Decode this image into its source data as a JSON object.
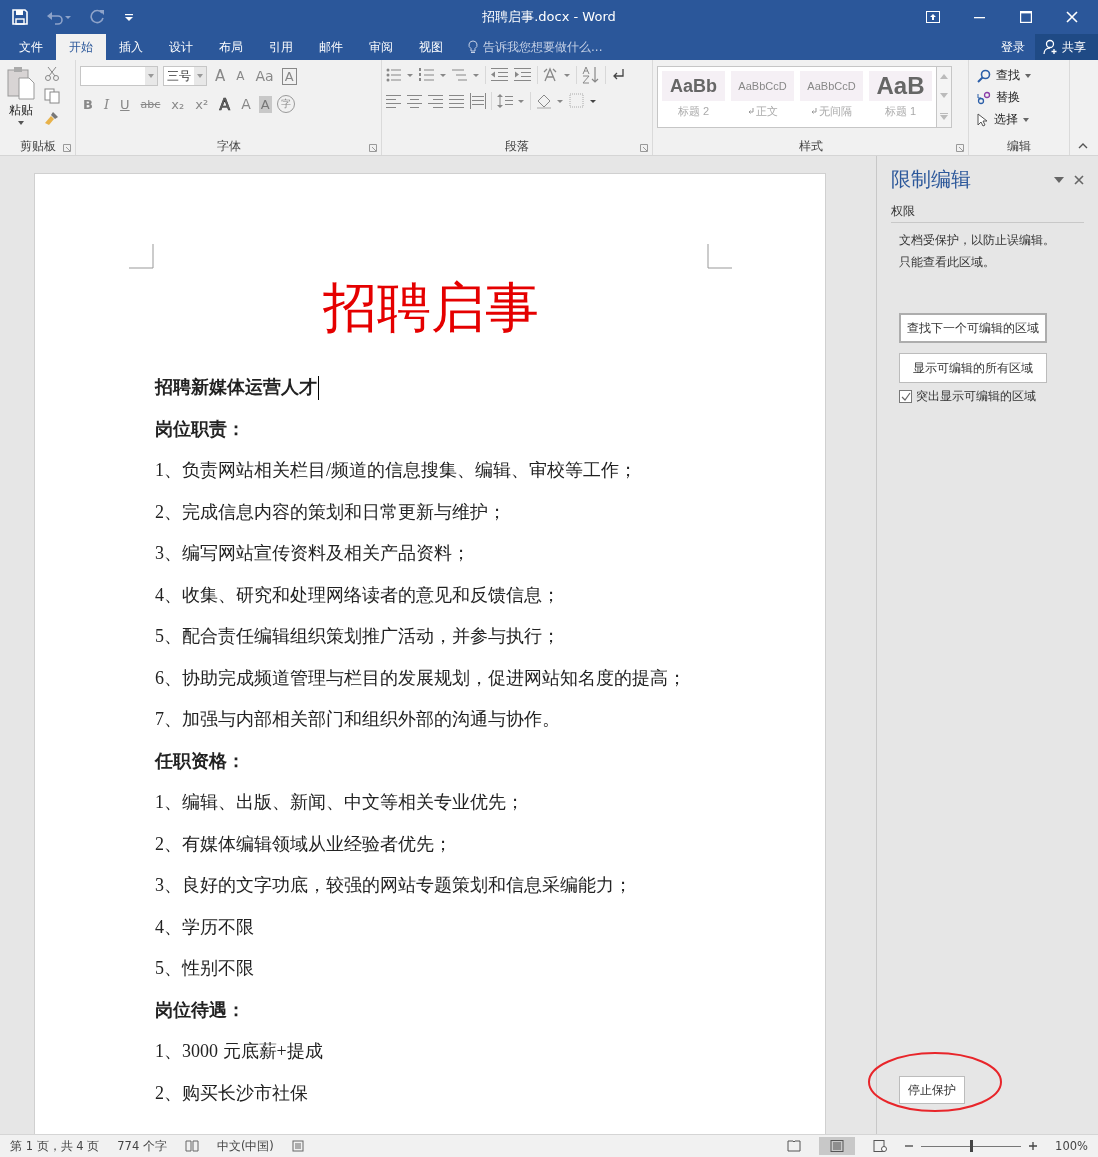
{
  "window": {
    "title": "招聘启事.docx - Word"
  },
  "tabs": [
    {
      "label": "文件",
      "selected": false
    },
    {
      "label": "开始",
      "selected": true
    },
    {
      "label": "插入",
      "selected": false
    },
    {
      "label": "设计",
      "selected": false
    },
    {
      "label": "布局",
      "selected": false
    },
    {
      "label": "引用",
      "selected": false
    },
    {
      "label": "邮件",
      "selected": false
    },
    {
      "label": "审阅",
      "selected": false
    },
    {
      "label": "视图",
      "selected": false
    }
  ],
  "tell_me": {
    "placeholder": "告诉我您想要做什么..."
  },
  "account": {
    "sign_in": "登录",
    "share": "共享"
  },
  "ribbon": {
    "clipboard": {
      "paste": "粘贴",
      "label": "剪贴板"
    },
    "font": {
      "size": "三号",
      "label": "字体",
      "row1": [
        {
          "label": "A",
          "kind": "grow"
        },
        {
          "label": "A",
          "kind": "shrink"
        },
        {
          "label": "Aa",
          "kind": "dropdown"
        },
        {
          "label": "A",
          "kind": "boxed"
        }
      ],
      "row2": [
        {
          "label": "B",
          "kind": "bold"
        },
        {
          "label": "I",
          "kind": "italic"
        },
        {
          "label": "U",
          "kind": "underline"
        },
        {
          "label": "abc",
          "kind": "strike"
        },
        {
          "label": "x₂",
          "kind": "plain"
        },
        {
          "label": "x²",
          "kind": "plain"
        },
        {
          "label": "A",
          "kind": "outline"
        },
        {
          "label": "A",
          "kind": "dropdown"
        },
        {
          "label": "A",
          "kind": "shaded"
        },
        {
          "label": "字",
          "kind": "circled"
        }
      ]
    },
    "paragraph": {
      "label": "段落"
    },
    "styles": {
      "label": "样式",
      "items": [
        {
          "preview": "AaBb",
          "name": "标题 2",
          "kind": "heading",
          "paragraph_mark": false
        },
        {
          "preview": "AaBbCcD",
          "name": "正文",
          "kind": "body",
          "paragraph_mark": true
        },
        {
          "preview": "AaBbCcD",
          "name": "无间隔",
          "kind": "body",
          "paragraph_mark": true
        },
        {
          "preview": "AaB",
          "name": "标题 1",
          "kind": "title",
          "paragraph_mark": false
        }
      ]
    },
    "editing": {
      "label": "编辑",
      "items": [
        {
          "label": "查找",
          "kind": "find"
        },
        {
          "label": "替换",
          "kind": "replace"
        },
        {
          "label": "选择",
          "kind": "select"
        }
      ]
    }
  },
  "document": {
    "title": "招聘启事",
    "lines": [
      {
        "text": "招聘新媒体运营人才",
        "kind": "heading"
      },
      {
        "text": "岗位职责：",
        "kind": "heading"
      },
      {
        "text": "1、负责网站相关栏目/频道的信息搜集、编辑、审校等工作；",
        "kind": "body"
      },
      {
        "text": "2、完成信息内容的策划和日常更新与维护；",
        "kind": "body"
      },
      {
        "text": "3、编写网站宣传资料及相关产品资料；",
        "kind": "body"
      },
      {
        "text": "4、收集、研究和处理网络读者的意见和反馈信息；",
        "kind": "body"
      },
      {
        "text": "5、配合责任编辑组织策划推广活动，并参与执行；",
        "kind": "body"
      },
      {
        "text": "6、协助完成频道管理与栏目的发展规划，促进网站知名度的提高；",
        "kind": "body"
      },
      {
        "text": "7、加强与内部相关部门和组织外部的沟通与协作。",
        "kind": "body"
      },
      {
        "text": "任职资格：",
        "kind": "heading"
      },
      {
        "text": "1、编辑、出版、新闻、中文等相关专业优先；",
        "kind": "body"
      },
      {
        "text": "2、有媒体编辑领域从业经验者优先；",
        "kind": "body"
      },
      {
        "text": "3、良好的文字功底，较强的网站专题策划和信息采编能力；",
        "kind": "body"
      },
      {
        "text": "4、学历不限",
        "kind": "body"
      },
      {
        "text": "5、性别不限",
        "kind": "body"
      },
      {
        "text": "岗位待遇：",
        "kind": "heading"
      },
      {
        "text": "1、3000 元底薪+提成",
        "kind": "body"
      },
      {
        "text": "2、购买长沙市社保",
        "kind": "body"
      }
    ]
  },
  "pane": {
    "title": "限制编辑",
    "section": "权限",
    "message": [
      "文档受保护，以防止误编辑。",
      "只能查看此区域。"
    ],
    "buttons": [
      "查找下一个可编辑的区域",
      "显示可编辑的所有区域"
    ],
    "highlight": {
      "label": "突出显示可编辑的区域",
      "checked": true
    },
    "stop_button": "停止保护"
  },
  "status_bar": {
    "page": "第 1 页，共 4 页",
    "words": "774 个字",
    "language": "中文(中国)",
    "zoom": {
      "level": 0.5,
      "reading": "100%"
    }
  }
}
